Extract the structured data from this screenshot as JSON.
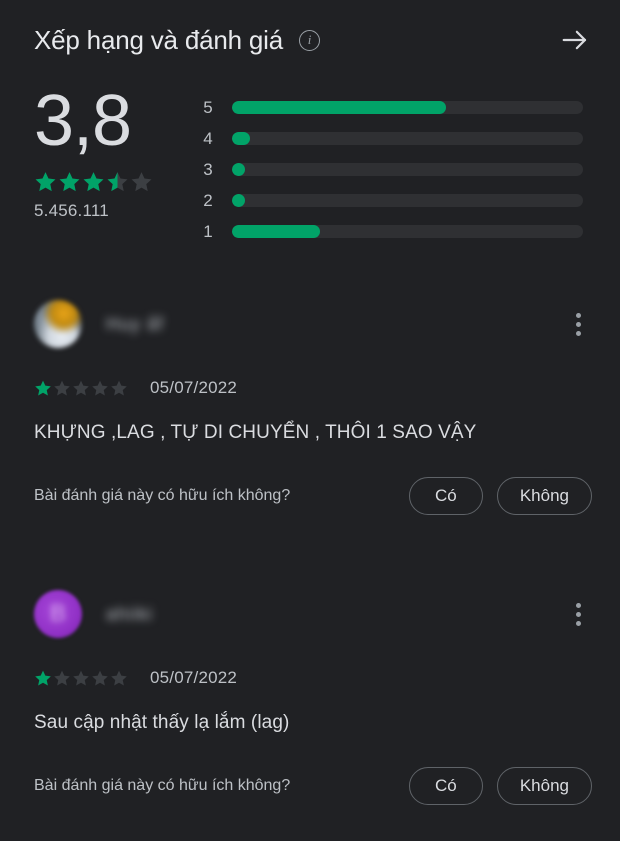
{
  "header": {
    "title": "Xếp hạng và đánh giá",
    "info_icon": "info-icon",
    "arrow_icon": "arrow-right-icon"
  },
  "summary": {
    "score": "3,8",
    "stars_filled": 3.5,
    "review_count": "5.456.111",
    "histogram": [
      {
        "label": "5",
        "percent": 61
      },
      {
        "label": "4",
        "percent": 5
      },
      {
        "label": "3",
        "percent": 3
      },
      {
        "label": "2",
        "percent": 3
      },
      {
        "label": "1",
        "percent": 25
      }
    ]
  },
  "colors": {
    "background": "#202124",
    "accent_green": "#01a368",
    "track": "#2f3033",
    "text_primary": "#dadce0",
    "text_secondary": "#bdc1c6",
    "avatar_purple": "#9333c8"
  },
  "reviews": [
    {
      "avatar_type": "photo",
      "avatar_initial": "",
      "name": "Huy ấf",
      "stars": 1,
      "date": "05/07/2022",
      "text": "KHỰNG ,LAG , TỰ DI CHUYỂN , THÔI 1 SAO VẬY",
      "helpful_question": "Bài đánh giá này có hữu ích không?",
      "yes_label": "Có",
      "no_label": "Không",
      "menu_icon": "more-vertical-icon"
    },
    {
      "avatar_type": "letter",
      "avatar_initial": "B",
      "name": "ahiiki",
      "stars": 1,
      "date": "05/07/2022",
      "text": "Sau cập nhật thấy lạ lắm (lag)",
      "helpful_question": "Bài đánh giá này có hữu ích không?",
      "yes_label": "Có",
      "no_label": "Không",
      "menu_icon": "more-vertical-icon"
    }
  ]
}
